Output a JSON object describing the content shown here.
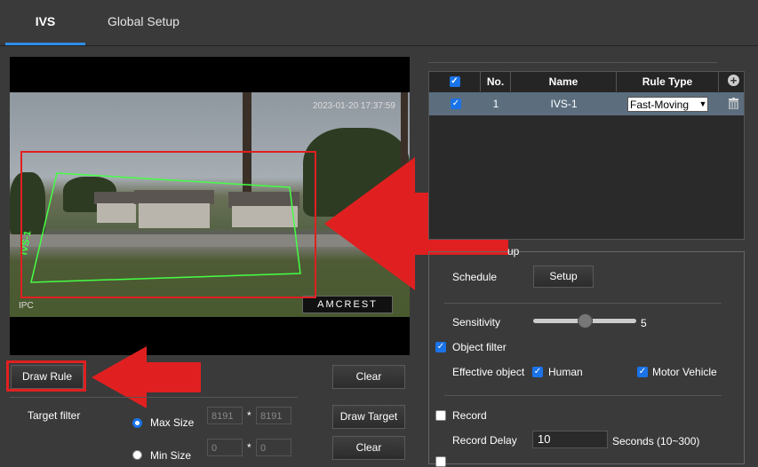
{
  "tabs": [
    {
      "label": "IVS",
      "active": true
    },
    {
      "label": "Global Setup",
      "active": false
    }
  ],
  "video": {
    "timestamp": "2023-01-20 17:37:59",
    "channel_label": "IPC",
    "logo_text": "AMCREST",
    "rule_overlay_label": "IVS-1"
  },
  "buttons": {
    "draw_rule": "Draw Rule",
    "clear": "Clear",
    "draw_target": "Draw Target",
    "clear_target": "Clear",
    "setup": "Setup"
  },
  "target_filter": {
    "label": "Target filter",
    "max_size_label": "Max Size",
    "max_w": "8191",
    "max_h": "8191",
    "min_size_label": "Min Size",
    "min_w": "0",
    "min_h": "0",
    "separator": "*",
    "selected": "Max Size"
  },
  "rule_table": {
    "headers": {
      "no": "No.",
      "name": "Name",
      "rule_type": "Rule Type"
    },
    "rows": [
      {
        "checked": true,
        "no": "1",
        "name": "IVS-1",
        "rule_type": "Fast-Moving"
      }
    ]
  },
  "config": {
    "section_title_fragment": "up",
    "schedule_label": "Schedule",
    "sensitivity_label": "Sensitivity",
    "sensitivity_value": "5",
    "sensitivity_fraction": 0.5,
    "object_filter_label": "Object filter",
    "object_filter_checked": true,
    "effective_object_label": "Effective object",
    "human_label": "Human",
    "human_checked": true,
    "motor_vehicle_label": "Motor Vehicle",
    "motor_vehicle_checked": true,
    "record_label": "Record",
    "record_checked": false,
    "record_delay_label": "Record Delay",
    "record_delay_value": "10",
    "record_delay_unit": "Seconds (10~300)"
  },
  "colors": {
    "accent": "#1a73e8",
    "annotation_red": "#e02020",
    "rule_green": "#45ff45"
  }
}
